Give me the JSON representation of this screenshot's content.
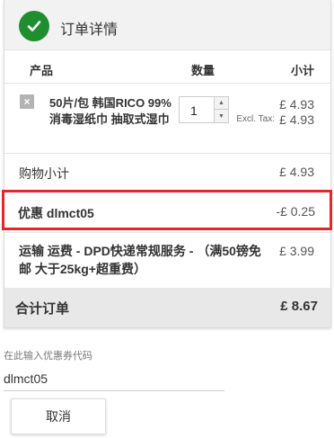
{
  "header": {
    "title": "订单详情",
    "icon": "check-icon",
    "icon_color": "#1f8e2e"
  },
  "columns": {
    "product": "产品",
    "quantity": "数量",
    "total": "小计"
  },
  "item": {
    "remove_icon": "×",
    "name": "50片/包 韩国RICO 99%消毒湿纸巾 抽取式湿巾",
    "quantity": "1",
    "price": "£ 4.93",
    "excl_tax_label": "Excl. Tax:",
    "excl_tax_price": "£ 4.93"
  },
  "subtotal": {
    "label": "购物小计",
    "value": "£ 4.93"
  },
  "discount": {
    "label": "优惠 dlmct05",
    "value": "-£ 0.25",
    "highlight_color": "#e8262a"
  },
  "shipping": {
    "label": "运输 运费 - DPD快递常规服务 - （满50镑免邮 大于25kg+超重费）",
    "value": "£ 3.99"
  },
  "grand_total": {
    "label": "合计订单",
    "value": "£ 8.67"
  },
  "coupon": {
    "hint": "在此输入优惠券代码",
    "value": "dlmct05"
  },
  "cancel_button": {
    "label": "取消"
  }
}
